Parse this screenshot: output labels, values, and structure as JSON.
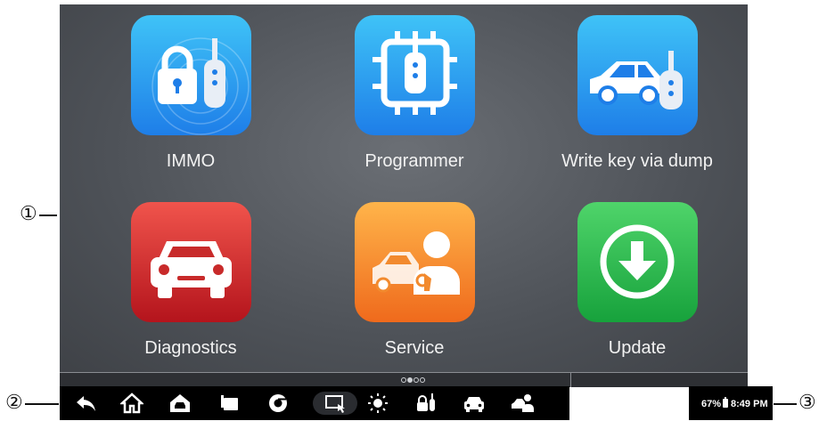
{
  "callouts": [
    "①",
    "②",
    "③"
  ],
  "apps": [
    {
      "label": "IMMO",
      "icon": "immo-key-lock-icon"
    },
    {
      "label": "Programmer",
      "icon": "programmer-chip-icon"
    },
    {
      "label": "Write key via dump",
      "icon": "car-key-icon"
    },
    {
      "label": "Diagnostics",
      "icon": "car-front-icon"
    },
    {
      "label": "Service",
      "icon": "service-technician-icon"
    },
    {
      "label": "Update",
      "icon": "download-arrow-icon"
    }
  ],
  "pager": {
    "pages": 4,
    "active": 1
  },
  "taskbar": [
    "back-icon",
    "home-icon",
    "car-home-icon",
    "recent-apps-icon",
    "browser-icon",
    "screen-capture-icon",
    "brightness-icon",
    "immo-shortcut-icon",
    "diagnostics-shortcut-icon",
    "service-shortcut-icon"
  ],
  "status": {
    "battery": "67%",
    "time": "8:49 PM"
  },
  "colors": {
    "blue": "#1e7ee8",
    "red": "#b4141c",
    "orange": "#ef6a1c",
    "green": "#17a23c"
  }
}
